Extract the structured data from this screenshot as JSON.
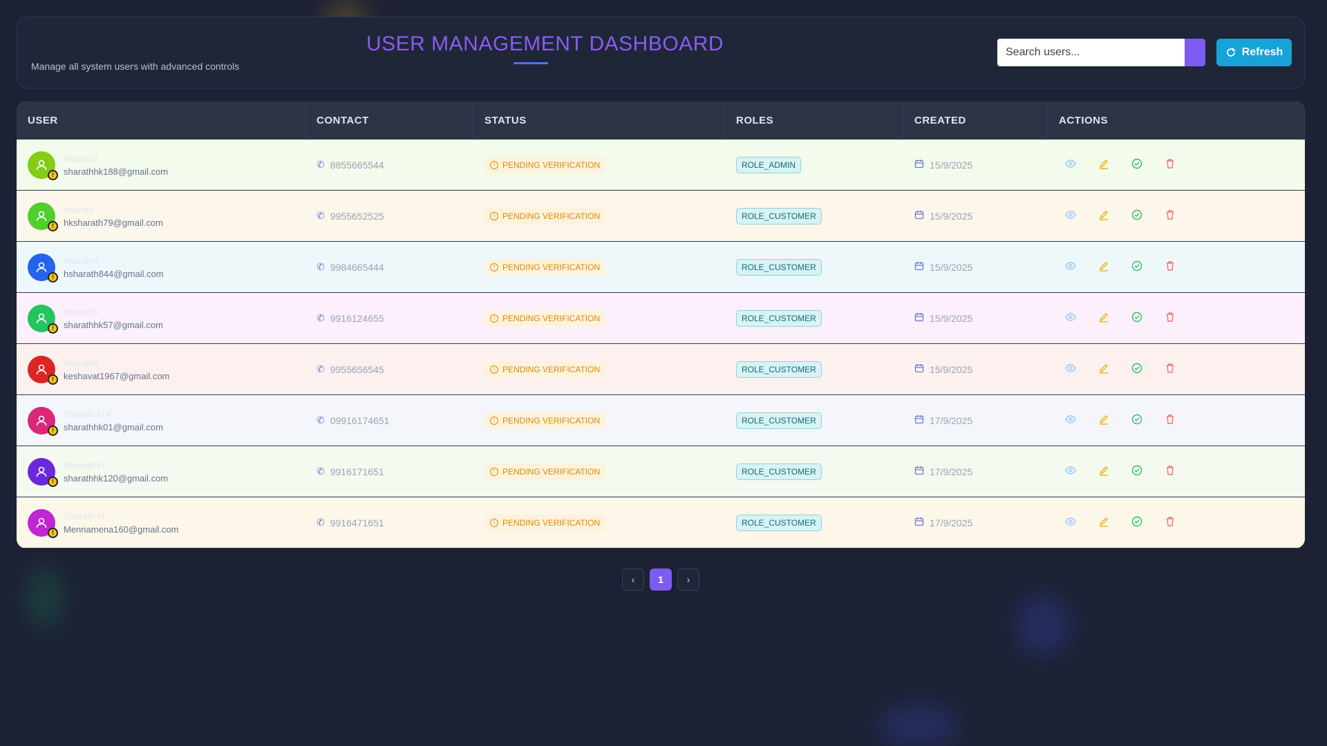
{
  "header": {
    "title": "USER MANAGEMENT DASHBOARD",
    "subtitle": "Manage all system users with advanced controls",
    "search_placeholder": "Search users...",
    "refresh_label": "Refresh"
  },
  "table": {
    "columns": [
      "USER",
      "CONTACT",
      "STATUS",
      "ROLES",
      "CREATED",
      "ACTIONS"
    ],
    "rows": [
      {
        "name": "sharath1",
        "email": "sharathhk188@gmail.com",
        "phone": "8855665544",
        "status": "PENDING VERIFICATION",
        "role": "ROLE_ADMIN",
        "created": "15/9/2025",
        "avatar_color": "#84cc16",
        "row_bg": "#f3fbec"
      },
      {
        "name": "sharath",
        "email": "hksharath79@gmail.com",
        "phone": "9955652525",
        "status": "PENDING VERIFICATION",
        "role": "ROLE_CUSTOMER",
        "created": "15/9/2025",
        "avatar_color": "#4fcf2b",
        "row_bg": "#fdf6ea"
      },
      {
        "name": "sharath4",
        "email": "hsharath844@gmail.com",
        "phone": "9984665444",
        "status": "PENDING VERIFICATION",
        "role": "ROLE_CUSTOMER",
        "created": "15/9/2025",
        "avatar_color": "#2563eb",
        "row_bg": "#eef8fb"
      },
      {
        "name": "sharath6",
        "email": "sharathhk57@gmail.com",
        "phone": "9916124655",
        "status": "PENDING VERIFICATION",
        "role": "ROLE_CUSTOMER",
        "created": "15/9/2025",
        "avatar_color": "#22c55e",
        "row_bg": "#fbf0fb"
      },
      {
        "name": "sharath4",
        "email": "keshavat1967@gmail.com",
        "phone": "9955656545",
        "status": "PENDING VERIFICATION",
        "role": "ROLE_CUSTOMER",
        "created": "15/9/2025",
        "avatar_color": "#dc2626",
        "row_bg": "#fdf1f0"
      },
      {
        "name": "Sharath H K",
        "email": "sharathhk01@gmail.com",
        "phone": "09916174651",
        "status": "PENDING VERIFICATION",
        "role": "ROLE_CUSTOMER",
        "created": "17/9/2025",
        "avatar_color": "#db2777",
        "row_bg": "#f5f6fb"
      },
      {
        "name": "Sharath H",
        "email": "sharathhk120@gmail.com",
        "phone": "9916171651",
        "status": "PENDING VERIFICATION",
        "role": "ROLE_CUSTOMER",
        "created": "17/9/2025",
        "avatar_color": "#6d28d9",
        "row_bg": "#f4faef"
      },
      {
        "name": "Sharath H",
        "email": "Mennamena160@gmail.com",
        "phone": "9916471651",
        "status": "PENDING VERIFICATION",
        "role": "ROLE_CUSTOMER",
        "created": "17/9/2025",
        "avatar_color": "#c026d3",
        "row_bg": "#fdf7ea"
      }
    ],
    "action_icons": [
      "eye-icon",
      "edit-icon",
      "check-circle-icon",
      "trash-icon"
    ],
    "action_colors": [
      "#93c5fd",
      "#eab308",
      "#22c55e",
      "#f87171"
    ]
  },
  "pagination": {
    "prev": "‹",
    "current": "1",
    "next": "›"
  }
}
